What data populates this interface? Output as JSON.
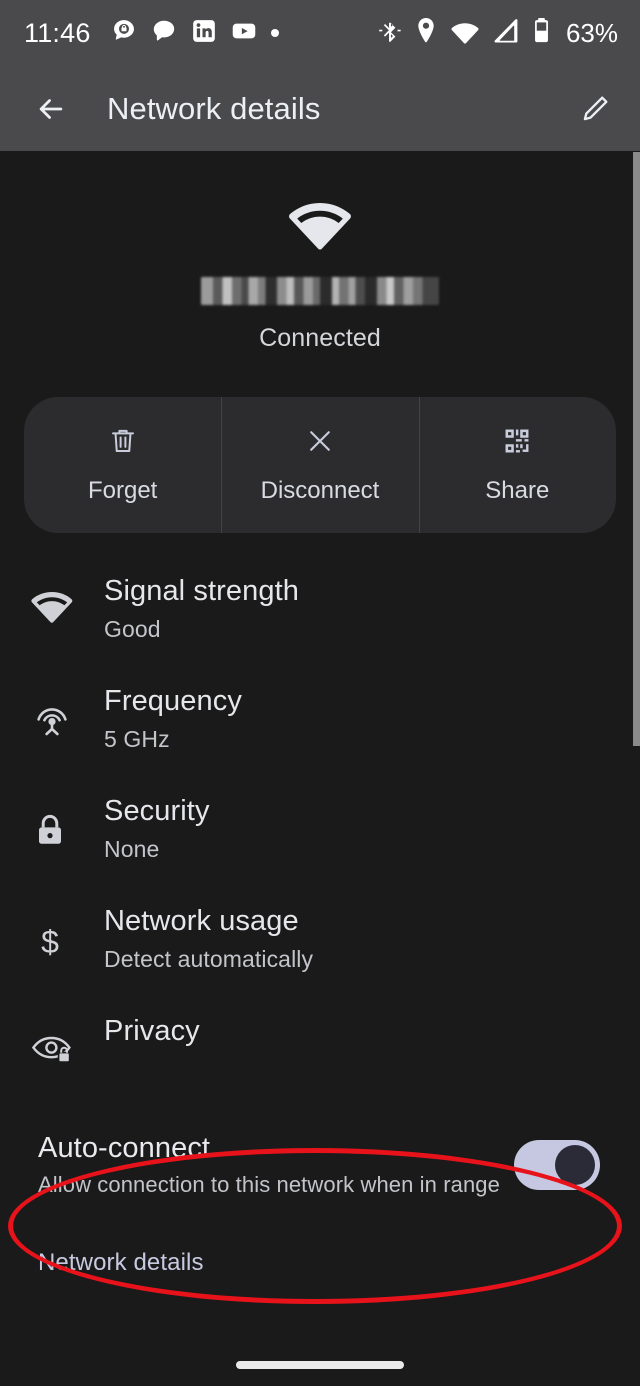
{
  "status_bar": {
    "clock": "11:46",
    "battery_percent": "63%",
    "notification_icons": [
      "message-lock-icon",
      "chat-bubble-icon",
      "linkedin-icon",
      "youtube-icon",
      "more-notifications-dot-icon"
    ],
    "system_icons": [
      "bluetooth-icon",
      "location-icon",
      "wifi-icon",
      "cellular-signal-icon",
      "battery-icon"
    ]
  },
  "app_bar": {
    "title": "Network details",
    "back_icon": "back-arrow-icon",
    "edit_icon": "pencil-edit-icon"
  },
  "hero": {
    "wifi_icon": "wifi-icon",
    "ssid": "",
    "ssid_redacted": true,
    "status": "Connected"
  },
  "actions": [
    {
      "label": "Forget",
      "icon": "trash-icon"
    },
    {
      "label": "Disconnect",
      "icon": "close-x-icon"
    },
    {
      "label": "Share",
      "icon": "qr-code-icon"
    }
  ],
  "details": [
    {
      "title": "Signal strength",
      "subtitle": "Good",
      "icon": "wifi-icon"
    },
    {
      "title": "Frequency",
      "subtitle": "5 GHz",
      "icon": "antenna-broadcast-icon"
    },
    {
      "title": "Security",
      "subtitle": "None",
      "icon": "lock-icon"
    },
    {
      "title": "Network usage",
      "subtitle": "Detect automatically",
      "icon": "dollar-sign-icon"
    },
    {
      "title": "Privacy",
      "subtitle": "",
      "icon": "eye-lock-icon"
    }
  ],
  "auto_connect": {
    "title": "Auto-connect",
    "subtitle": "Allow connection to this network when in range",
    "enabled": true
  },
  "bottom_section": {
    "header": "Network details"
  },
  "annotation": {
    "shape": "ellipse",
    "color": "#e8131a",
    "target": "auto-connect-row"
  },
  "colors": {
    "app_bar_background": "#4a4a4c",
    "page_background": "#1a1a1a",
    "action_panel_background": "#2c2c2e",
    "accent": "#c5c8e0",
    "annotation_red": "#e8131a"
  }
}
